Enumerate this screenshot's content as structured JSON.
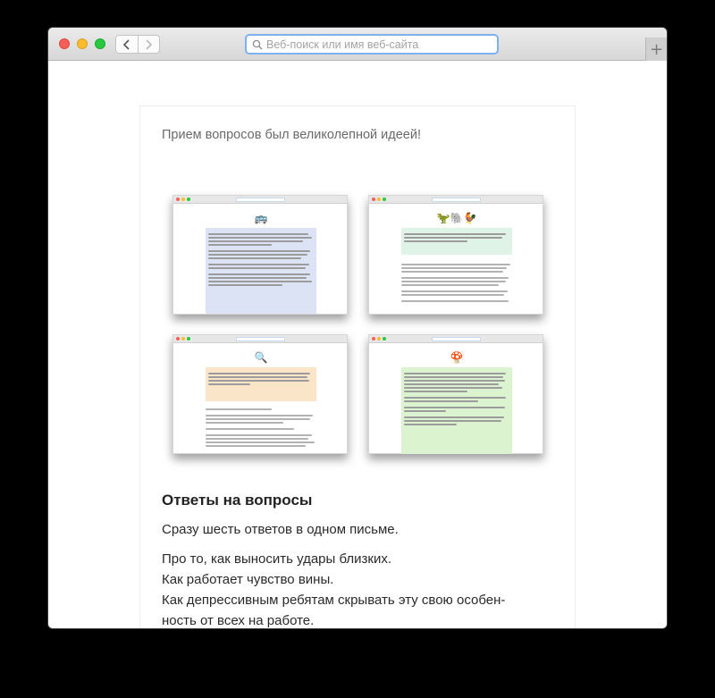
{
  "browser": {
    "address_placeholder": "Веб-поиск или имя веб-сайта",
    "new_tab_label": "+"
  },
  "article": {
    "intro": "Прием вопросов был великолепной идеей!",
    "thumbnails": [
      {
        "emoji": "🚌",
        "quote_color": "#dbe3f5"
      },
      {
        "emoji": "🦖🐘🐓",
        "quote_color": "#dff3e6"
      },
      {
        "emoji": "🔍",
        "quote_color": "#fbe5c8"
      },
      {
        "emoji": "🍄",
        "quote_color": "#dcf3cf"
      }
    ],
    "heading": "Ответы на вопросы",
    "lead": "Сразу шесть ответов в одном письме.",
    "lines": [
      "Про то, как выносить удары близких.",
      "Как работает чувство вины.",
      "Как депрессивным ребятам скрывать эту свою особен-",
      "ность от всех на работе."
    ]
  },
  "colors": {
    "address_focus": "#7fb1ef",
    "close": "#fc5f57",
    "minimize": "#fdbc2e",
    "zoom": "#28c940"
  }
}
